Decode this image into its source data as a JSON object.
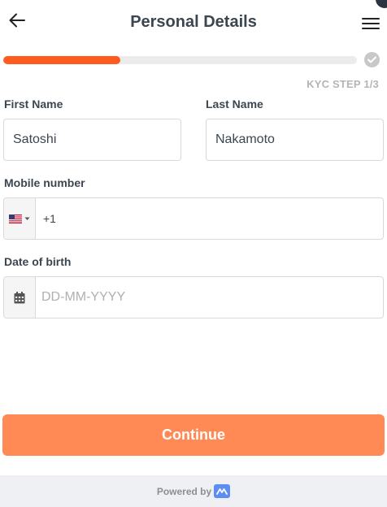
{
  "header": {
    "title": "Personal Details"
  },
  "progress": {
    "fraction": 0.33,
    "step_label": "KYC STEP 1/3"
  },
  "form": {
    "first_name": {
      "label": "First Name",
      "value": "Satoshi"
    },
    "last_name": {
      "label": "Last Name",
      "value": "Nakamoto"
    },
    "mobile": {
      "label": "Mobile number",
      "country": "US",
      "dial_code": "+1",
      "value": ""
    },
    "dob": {
      "label": "Date of birth",
      "placeholder": "DD-MM-YYYY",
      "value": ""
    }
  },
  "actions": {
    "continue_label": "Continue"
  },
  "footer": {
    "powered_by": "Powered by"
  },
  "colors": {
    "progress": "#ff5a1f",
    "button": "#ff8a56",
    "title": "#3c4650"
  },
  "icons": {
    "back": "arrow-left-icon",
    "menu": "hamburger-menu-icon",
    "progress_done": "check-circle-icon",
    "first_name_field": "contact-card-icon",
    "flag": "us-flag-icon",
    "dropdown": "caret-down-icon",
    "calendar": "calendar-icon",
    "brand": "brand-logo-icon"
  }
}
